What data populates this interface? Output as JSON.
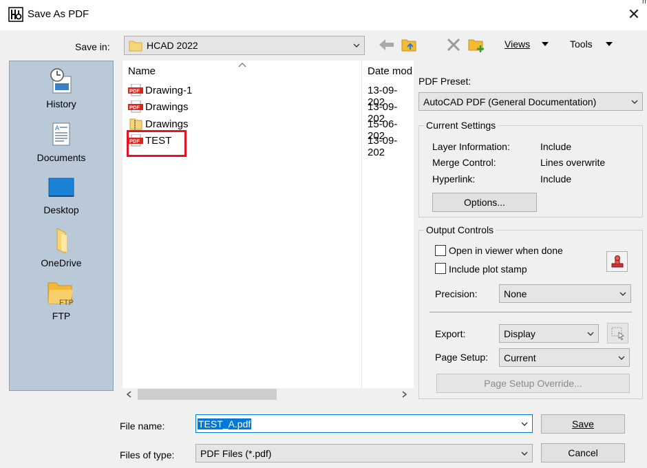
{
  "window": {
    "title": "Save As PDF",
    "corner_mark": "m"
  },
  "toolbar": {
    "save_in_label": "Save in:",
    "save_in_value": "HCAD 2022",
    "views_label": "Views",
    "tools_label": "Tools"
  },
  "places": [
    {
      "label": "History",
      "icon": "history-icon"
    },
    {
      "label": "Documents",
      "icon": "documents-icon"
    },
    {
      "label": "Desktop",
      "icon": "desktop-icon"
    },
    {
      "label": "OneDrive",
      "icon": "onedrive-folder-icon"
    },
    {
      "label": "FTP",
      "icon": "ftp-folder-icon",
      "badge": "FTP"
    }
  ],
  "file_list": {
    "columns": [
      "Name",
      "Date mod"
    ],
    "rows": [
      {
        "name": "Drawing-1",
        "date": "13-09-202",
        "icon": "pdf-file-icon"
      },
      {
        "name": "Drawings",
        "date": "13-09-202",
        "icon": "pdf-file-icon"
      },
      {
        "name": "Drawings",
        "date": "15-06-202",
        "icon": "zip-folder-icon"
      },
      {
        "name": "TEST",
        "date": "13-09-202",
        "icon": "pdf-file-icon",
        "highlighted": true
      }
    ],
    "pdf_badge": "PDF"
  },
  "pdf_preset": {
    "label": "PDF Preset:",
    "value": "AutoCAD PDF (General Documentation)"
  },
  "current_settings": {
    "title": "Current Settings",
    "rows": [
      {
        "key": "Layer Information:",
        "value": "Include"
      },
      {
        "key": "Merge Control:",
        "value": "Lines overwrite"
      },
      {
        "key": "Hyperlink:",
        "value": "Include"
      }
    ],
    "options_button": "Options..."
  },
  "output_controls": {
    "title": "Output Controls",
    "open_in_viewer": "Open in viewer when done",
    "include_plot_stamp": "Include plot stamp",
    "precision_label": "Precision:",
    "precision_value": "None",
    "export_label": "Export:",
    "export_value": "Display",
    "page_setup_label": "Page Setup:",
    "page_setup_value": "Current",
    "page_setup_override": "Page Setup Override..."
  },
  "footer": {
    "file_name_label": "File name:",
    "file_name_value": "TEST_A.pdf",
    "file_type_label": "Files of type:",
    "file_type_value": "PDF Files (*.pdf)",
    "save_button": "Save",
    "cancel_button": "Cancel"
  },
  "colors": {
    "accent": "#0078d7",
    "highlight_box": "#e81123",
    "pdf_red": "#d9261c",
    "places_bg": "#bac9d8"
  }
}
